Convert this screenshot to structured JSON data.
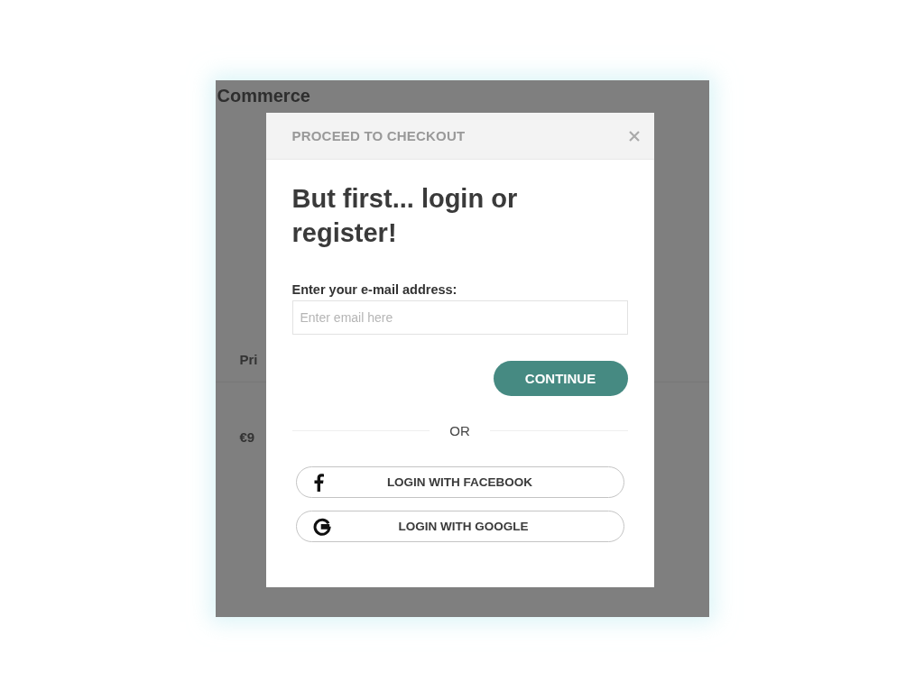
{
  "background": {
    "title": "Commerce",
    "column_label": "Pri",
    "cell": "€9"
  },
  "dialog": {
    "title": "PROCEED TO CHECKOUT",
    "heading": "But first... login or register!",
    "email": {
      "label": "Enter your e-mail address:",
      "placeholder": "Enter email here"
    },
    "continue_button": "CONTINUE",
    "divider": "OR",
    "social_buttons": [
      {
        "kind": "facebook",
        "label": "LOGIN WITH FACEBOOK"
      },
      {
        "kind": "google",
        "label": "LOGIN WITH GOOGLE"
      }
    ]
  }
}
